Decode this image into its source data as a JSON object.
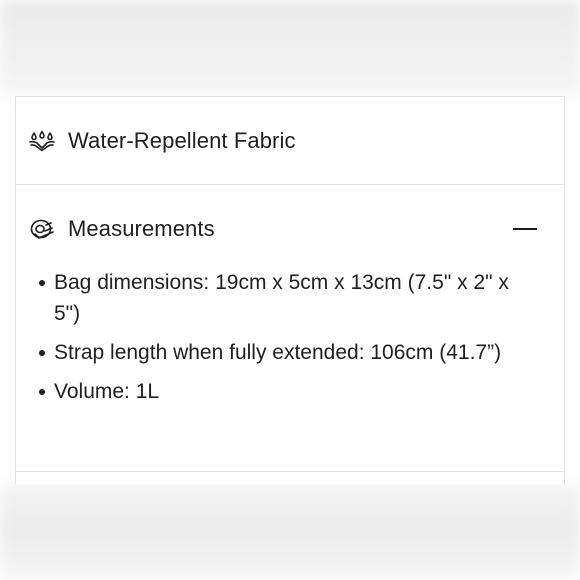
{
  "features": {
    "fabric": {
      "label": "Water-Repellent Fabric",
      "icon": "water-drops-icon"
    },
    "measurements": {
      "label": "Measurements",
      "icon": "measuring-tape-icon",
      "toggle_state": "expanded",
      "items": [
        "Bag dimensions: 19cm x 5cm x 13cm (7.5\" x 2\" x 5\")",
        "Strap length when fully extended: 106cm (41.7”)",
        "Volume: 1L"
      ]
    }
  },
  "colors": {
    "text": "#1f1f1f",
    "divider": "#e3e3e3",
    "background": "#ffffff"
  }
}
